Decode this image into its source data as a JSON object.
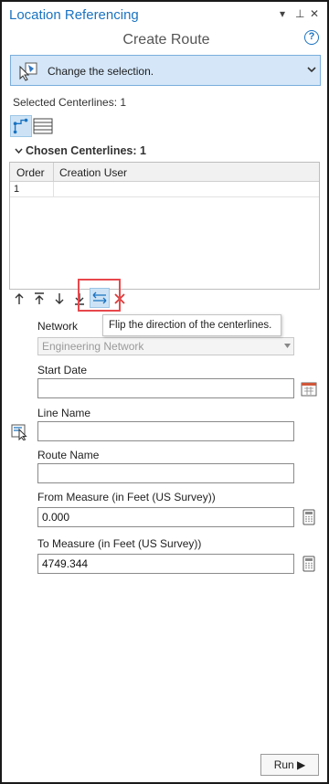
{
  "pane": {
    "title": "Location Referencing",
    "subtitle": "Create Route",
    "controls": {
      "menu": "▾",
      "pin": "⊥",
      "close": "✕",
      "help": "?"
    }
  },
  "selection": {
    "label": "Change the selection."
  },
  "selected_count": "Selected Centerlines: 1",
  "chosen": {
    "header": "Chosen Centerlines: 1",
    "columns": [
      "Order",
      "Creation User"
    ],
    "rows": [
      {
        "order": "1",
        "creation_user": ""
      }
    ]
  },
  "tooltip": "Flip the direction of the centerlines.",
  "fields": {
    "network_label": "Network",
    "network_value": "Engineering Network",
    "start_date_label": "Start Date",
    "start_date_value": "",
    "line_name_label": "Line Name",
    "line_name_value": "",
    "route_name_label": "Route Name",
    "route_name_value": "",
    "from_measure_label": "From Measure (in Feet (US Survey))",
    "from_measure_value": "0.000",
    "to_measure_label": "To Measure (in Feet (US Survey))",
    "to_measure_value": "4749.344"
  },
  "run_button": "Run ▶",
  "colors": {
    "accent": "#1a73c1",
    "selection_bar": "#d4e6f8",
    "highlight": "#e8484c"
  }
}
